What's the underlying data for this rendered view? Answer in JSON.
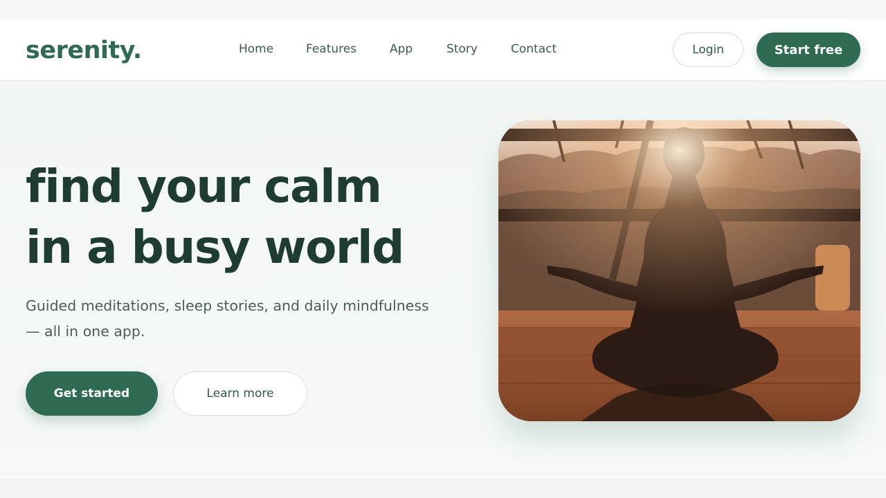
{
  "brand": {
    "logo": "serenity."
  },
  "nav": {
    "links": [
      "Home",
      "Features",
      "App",
      "Story",
      "Contact"
    ],
    "login_label": "Login",
    "cta_label": "Start free"
  },
  "hero": {
    "title_line1": "find your calm",
    "title_line2": "in a busy world",
    "subtitle_line1": "Guided meditations, sleep stories, and daily mindfulness",
    "subtitle_line2": "— all in one app.",
    "primary_cta": "Get started",
    "secondary_cta": "Learn more",
    "image_subject": "woman meditating at sunset"
  },
  "colors": {
    "brand_green": "#2f6b52",
    "heading": "#1e3d30",
    "body_text": "#4b5c55"
  }
}
